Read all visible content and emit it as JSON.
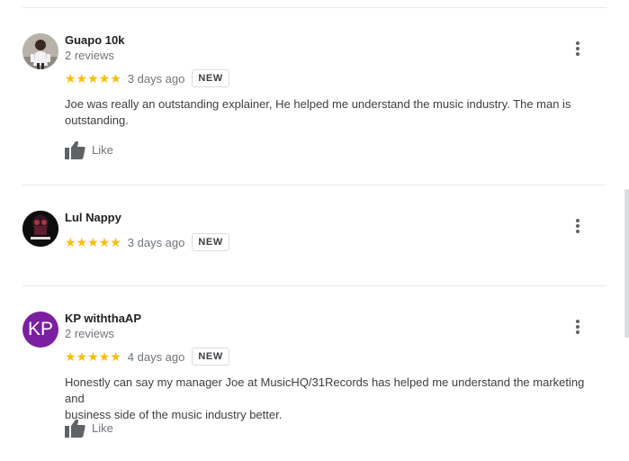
{
  "reviews": [
    {
      "name": "Guapo 10k",
      "review_count": "2 reviews",
      "stars": "★★★★★",
      "time_ago": "3 days ago",
      "badge": "NEW",
      "text_line1": "Joe was really an outstanding explainer, He helped me understand the music industry. The man is",
      "text_line2": "outstanding.",
      "like_label": "Like",
      "rating": 5
    },
    {
      "name": "Lul Nappy",
      "stars": "★★★★★",
      "time_ago": "3 days ago",
      "badge": "NEW",
      "rating": 5
    },
    {
      "name": "KP withthaAP",
      "avatar_initials": "KP",
      "review_count": "2 reviews",
      "stars": "★★★★★",
      "time_ago": "4 days ago",
      "badge": "NEW",
      "text_line1": "Honestly can say my manager Joe at MusicHQ/31Records has helped me understand the marketing and",
      "text_line2": "business side of the music industry better.",
      "like_label": "Like",
      "rating": 5
    }
  ],
  "icons": {
    "like": "thumbs-up-icon",
    "more": "more-vert-icon",
    "star": "star-icon"
  },
  "colors": {
    "star": "#fbbc04",
    "avatar_kp": "#7b1fa2",
    "divider": "#e8eaed",
    "secondary_text": "#70757a"
  }
}
